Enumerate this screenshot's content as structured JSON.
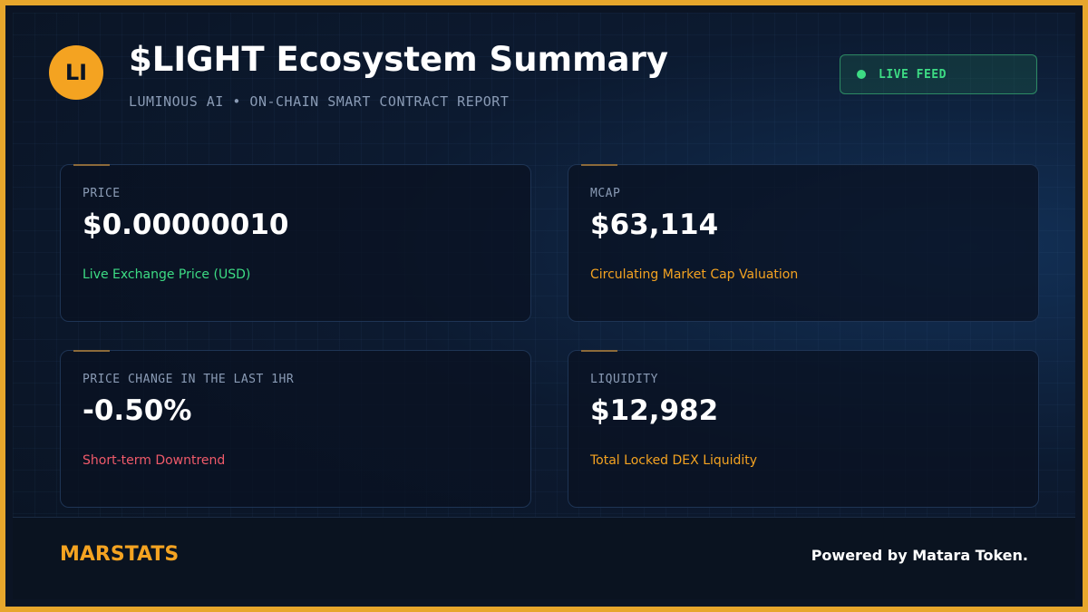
{
  "header": {
    "logo_text": "LI",
    "title": "$LIGHT Ecosystem Summary",
    "subtitle": "LUMINOUS AI • ON-CHAIN SMART CONTRACT REPORT",
    "live_badge": "LIVE FEED"
  },
  "cards": [
    {
      "label": "PRICE",
      "value": "$0.00000010",
      "caption": "Live Exchange Price (USD)",
      "caption_color": "#3ddc84"
    },
    {
      "label": "MCAP",
      "value": "$63,114",
      "caption": "Circulating Market Cap Valuation",
      "caption_color": "#f4a321"
    },
    {
      "label": "PRICE CHANGE IN THE LAST 1HR",
      "value": "-0.50%",
      "caption": "Short-term Downtrend",
      "caption_color": "#f05a6a"
    },
    {
      "label": "LIQUIDITY",
      "value": "$12,982",
      "caption": "Total Locked DEX Liquidity",
      "caption_color": "#f4a321"
    }
  ],
  "footer": {
    "brand": "MARSTATS",
    "powered_by": "Powered by Matara Token."
  },
  "colors": {
    "accent": "#f4a321",
    "border": "#e7a62c",
    "positive": "#3ddc84",
    "negative": "#f05a6a",
    "background": "#0b1424"
  }
}
